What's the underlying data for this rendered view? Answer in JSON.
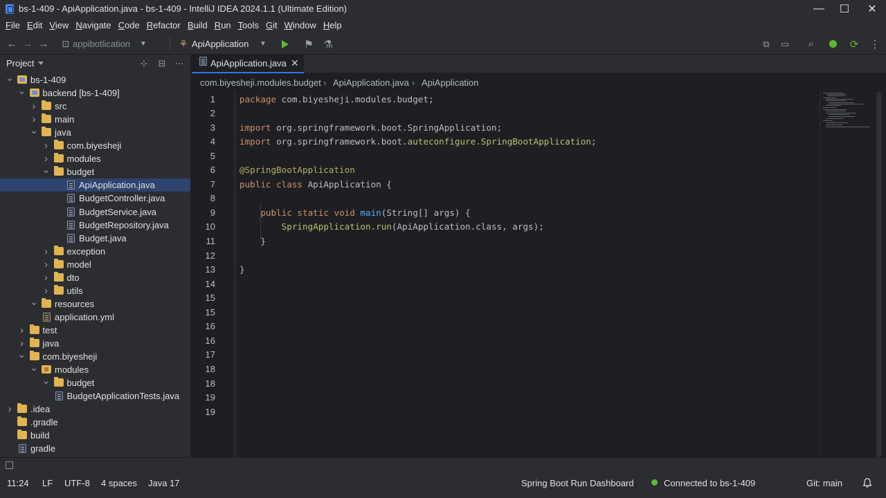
{
  "window": {
    "title": "bs-1-409 - ApiApplication.java - bs-1-409 - IntelliJ IDEA 2024.1.1 (Ultimate Edition)",
    "minimize": "—",
    "maximize": "☐",
    "close": "✕"
  },
  "menu": [
    {
      "label": "File",
      "mnemonic": "F",
      "rest": "ile"
    },
    {
      "label": "Edit",
      "mnemonic": "E",
      "rest": "dit"
    },
    {
      "label": "View",
      "mnemonic": "V",
      "rest": "iew"
    },
    {
      "label": "Navigate",
      "mnemonic": "N",
      "rest": "avigate"
    },
    {
      "label": "Code",
      "mnemonic": "C",
      "rest": "ode"
    },
    {
      "label": "Refactor",
      "mnemonic": "R",
      "rest": "efactor"
    },
    {
      "label": "Build",
      "mnemonic": "B",
      "rest": "uild"
    },
    {
      "label": "Run",
      "mnemonic": "R",
      "rest": "un"
    },
    {
      "label": "Tools",
      "mnemonic": "T",
      "rest": "ools"
    },
    {
      "label": "Git",
      "mnemonic": "G",
      "rest": "it"
    },
    {
      "label": "Window",
      "mnemonic": "W",
      "rest": "indow"
    },
    {
      "label": "Help",
      "mnemonic": "H",
      "rest": "elp"
    }
  ],
  "toolbar": {
    "project_widget": "appibotlication",
    "run_config": "ApiApplication",
    "icons": [
      "back-icon",
      "forward-icon",
      "run-icon",
      "debug-icon",
      "profile-icon",
      "vcs-icon",
      "layout-icon",
      "search-icon",
      "status-dot-icon",
      "update-icon",
      "more-icon"
    ]
  },
  "project_panel": {
    "title": "Project",
    "tree": [
      {
        "label": "bs-1-409",
        "type": "module",
        "depth": 0,
        "expanded": true
      },
      {
        "label": "backend [bs-1-409]",
        "type": "module",
        "depth": 1,
        "expanded": true
      },
      {
        "label": "src",
        "type": "folder",
        "depth": 2,
        "expanded": false
      },
      {
        "label": "main",
        "type": "folder",
        "depth": 2,
        "expanded": false
      },
      {
        "label": "java",
        "type": "folder",
        "depth": 2,
        "expanded": true
      },
      {
        "label": "com.biyesheji",
        "type": "folder",
        "depth": 3,
        "expanded": false
      },
      {
        "label": "modules",
        "type": "folder",
        "depth": 3,
        "expanded": false
      },
      {
        "label": "budget",
        "type": "folder",
        "depth": 3,
        "expanded": true
      },
      {
        "label": "ApiApplication.java",
        "type": "file",
        "depth": 4,
        "selected": true
      },
      {
        "label": "BudgetController.java",
        "type": "file",
        "depth": 4
      },
      {
        "label": "BudgetService.java",
        "type": "file",
        "depth": 4
      },
      {
        "label": "BudgetRepository.java",
        "type": "file",
        "depth": 4
      },
      {
        "label": "Budget.java",
        "type": "file",
        "depth": 4
      },
      {
        "label": "exception",
        "type": "folder",
        "depth": 3,
        "expanded": false
      },
      {
        "label": "model",
        "type": "folder",
        "depth": 3,
        "expanded": false
      },
      {
        "label": "dto",
        "type": "folder",
        "depth": 3,
        "expanded": false
      },
      {
        "label": "utils",
        "type": "folder",
        "depth": 3,
        "expanded": false
      },
      {
        "label": "resources",
        "type": "folder",
        "depth": 2,
        "expanded": true
      },
      {
        "label": "application.yml",
        "type": "yml",
        "depth": 2
      },
      {
        "label": "test",
        "type": "folder",
        "depth": 1,
        "expanded": false
      },
      {
        "label": "java",
        "type": "folder",
        "depth": 1,
        "expanded": false
      },
      {
        "label": "com.biyesheji",
        "type": "folder",
        "depth": 1,
        "expanded": true
      },
      {
        "label": "modules",
        "type": "package",
        "depth": 2,
        "expanded": true
      },
      {
        "label": "budget",
        "type": "folder",
        "depth": 3,
        "expanded": true
      },
      {
        "label": "BudgetApplicationTests.java",
        "type": "file",
        "depth": 3
      },
      {
        "label": ".idea",
        "type": "folder",
        "depth": 0,
        "expanded": false
      },
      {
        "label": ".gradle",
        "type": "folder",
        "depth": 0,
        "leaf": true
      },
      {
        "label": "build",
        "type": "folder",
        "depth": 0,
        "leaf": true
      },
      {
        "label": "gradle",
        "type": "file",
        "depth": 0,
        "leaf": true
      }
    ]
  },
  "editor": {
    "tab_label": "ApiApplication.java",
    "tab_close": "✕",
    "breadcrumb": [
      "com.biyesheji.modules.budget",
      "ApiApplication.java",
      "ApiApplication"
    ],
    "breadcrumb_sep": "›",
    "lines": [
      {
        "n": "1",
        "tokens": [
          [
            "k",
            "package "
          ],
          [
            "t",
            "com.biyesheji.modules.budget;"
          ]
        ]
      },
      {
        "n": "2",
        "tokens": []
      },
      {
        "n": "3",
        "tokens": [
          [
            "k",
            "import "
          ],
          [
            "t",
            "org.springframework.boot.SpringApplication;"
          ]
        ]
      },
      {
        "n": "4",
        "tokens": [
          [
            "k",
            "import "
          ],
          [
            "t",
            "org.springframework.boot."
          ],
          [
            "sf",
            "auteconfigure.SpringBootApplication"
          ],
          [
            "t",
            ";"
          ]
        ]
      },
      {
        "n": "5",
        "tokens": []
      },
      {
        "n": "6",
        "tokens": [
          [
            "a",
            "@SpringBootApplication"
          ]
        ]
      },
      {
        "n": "7",
        "tokens": [
          [
            "k",
            "public class "
          ],
          [
            "t",
            "ApiApplication {"
          ]
        ]
      },
      {
        "n": "8",
        "tokens": []
      },
      {
        "n": "9",
        "tokens": [
          [
            "t",
            "    "
          ],
          [
            "k",
            "public static void "
          ],
          [
            "f",
            "main"
          ],
          [
            "t",
            "(String[] args) {"
          ]
        ]
      },
      {
        "n": "10",
        "tokens": [
          [
            "t",
            "        "
          ],
          [
            "sf",
            "SpringApplication.run"
          ],
          [
            "t",
            "(ApiApplication.class, args);"
          ]
        ]
      },
      {
        "n": "11",
        "tokens": [
          [
            "t",
            "    }"
          ]
        ]
      },
      {
        "n": "12",
        "tokens": []
      },
      {
        "n": "13",
        "tokens": [
          [
            "t",
            "}"
          ]
        ]
      },
      {
        "n": "14",
        "tokens": []
      },
      {
        "n": "15",
        "tokens": []
      },
      {
        "n": "15",
        "tokens": []
      },
      {
        "n": "16",
        "tokens": []
      },
      {
        "n": "16",
        "tokens": []
      },
      {
        "n": "17",
        "tokens": []
      },
      {
        "n": "18",
        "tokens": []
      },
      {
        "n": "18",
        "tokens": []
      },
      {
        "n": "19",
        "tokens": []
      },
      {
        "n": "19",
        "tokens": []
      }
    ]
  },
  "status": {
    "position": "11:24",
    "line_sep": "LF",
    "encoding": "UTF-8",
    "indent": "4 spaces",
    "language": "Java 17",
    "dashboard": "Spring Boot Run Dashboard",
    "connection": "Connected to bs-1-409",
    "git": "Git: main"
  },
  "colors": {
    "background": "#1e1f22",
    "panel": "#2b2d30",
    "selection": "#2e436e",
    "accent": "#3574f0",
    "run_green": "#5fb832",
    "keyword": "#cf8e6d",
    "annotation": "#b3ae60",
    "method": "#56a8f5"
  }
}
